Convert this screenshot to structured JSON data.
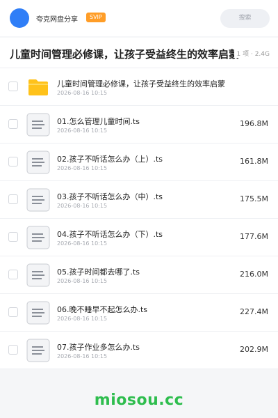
{
  "header": {
    "owner_name": "夸克网盘分享",
    "badge": "SVIP",
    "search_placeholder": "搜索"
  },
  "share": {
    "title": "儿童时间管理必修课，让孩子受益终生的效率启蒙",
    "meta": "1 项 · 2.4G"
  },
  "files": [
    {
      "name": "儿童时间管理必修课，让孩子受益终生的效率启蒙",
      "date": "2026-08-16 10:15",
      "size": "",
      "type": "folder-icon"
    },
    {
      "name": "01.怎么管理儿童时间.ts",
      "date": "2026-08-16 10:15",
      "size": "196.8M",
      "type": "file-icon"
    },
    {
      "name": "02.孩子不听话怎么办（上）.ts",
      "date": "2026-08-16 10:15",
      "size": "161.8M",
      "type": "file-icon"
    },
    {
      "name": "03.孩子不听话怎么办（中）.ts",
      "date": "2026-08-16 10:15",
      "size": "175.5M",
      "type": "file-icon"
    },
    {
      "name": "04.孩子不听话怎么办（下）.ts",
      "date": "2026-08-16 10:15",
      "size": "177.6M",
      "type": "file-icon"
    },
    {
      "name": "05.孩子时间都去哪了.ts",
      "date": "2026-08-16 10:15",
      "size": "216.0M",
      "type": "file-icon"
    },
    {
      "name": "06.晚不睡早不起怎么办.ts",
      "date": "2026-08-16 10:15",
      "size": "227.4M",
      "type": "file-icon"
    },
    {
      "name": "07.孩子作业多怎么办.ts",
      "date": "2026-08-16 10:15",
      "size": "202.9M",
      "type": "file-icon"
    }
  ],
  "watermark": "miosou.cc",
  "colors": {
    "accent": "#2f7ef7",
    "badge": "#ff9d27",
    "folder": "#ffc21a",
    "watermark": "#2ebd4e"
  }
}
